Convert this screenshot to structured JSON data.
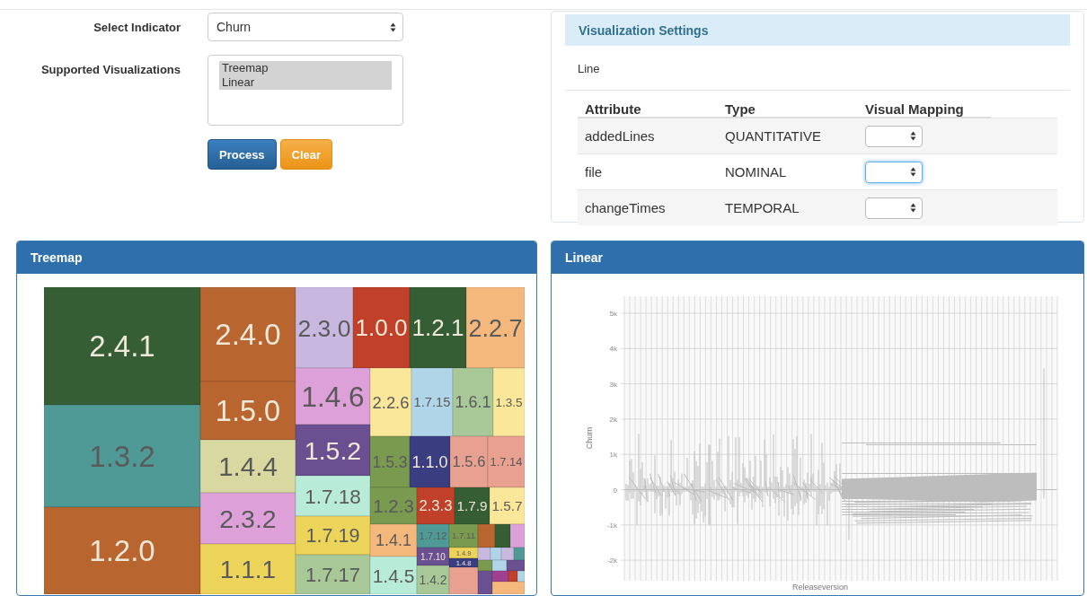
{
  "form": {
    "indicator_label": "Select Indicator",
    "indicator_value": "Churn",
    "visualizations_label": "Supported Visualizations",
    "visualizations": [
      {
        "label": "Treemap",
        "selected": true
      },
      {
        "label": "Linear",
        "selected": true
      }
    ],
    "buttons": [
      {
        "label": "Process",
        "kind": "primary"
      },
      {
        "label": "Clear",
        "kind": "warning"
      }
    ]
  },
  "settings": {
    "title": "Visualization Settings",
    "subtitle": "Line",
    "columns": [
      "Attribute",
      "Type",
      "Visual Mapping"
    ],
    "rows": [
      {
        "attribute": "addedLines",
        "type": "QUANTITATIVE",
        "focused": false
      },
      {
        "attribute": "file",
        "type": "NOMINAL",
        "focused": true
      },
      {
        "attribute": "changeTimes",
        "type": "TEMPORAL",
        "focused": false
      }
    ]
  },
  "treemap": {
    "title": "Treemap",
    "cells": [
      {
        "label": "2.4.1",
        "color": "#355e35"
      },
      {
        "label": "1.3.2",
        "color": "#4f9a96"
      },
      {
        "label": "1.2.0",
        "color": "#b8652f"
      },
      {
        "label": "2.4.0",
        "color": "#b8652f"
      },
      {
        "label": "1.5.0",
        "color": "#b8652f"
      },
      {
        "label": "1.4.4",
        "color": "#d8d8a0"
      },
      {
        "label": "2.3.2",
        "color": "#dda0d8"
      },
      {
        "label": "1.1.1",
        "color": "#ecd35a"
      },
      {
        "label": "2.3.0",
        "color": "#c8b8e0"
      },
      {
        "label": "1.0.0",
        "color": "#c0402a"
      },
      {
        "label": "1.2.1",
        "color": "#355e35"
      },
      {
        "label": "2.2.7",
        "color": "#f4b87c"
      },
      {
        "label": "1.4.6",
        "color": "#dda0d8"
      },
      {
        "label": "2.2.6",
        "color": "#fbe79a"
      },
      {
        "label": "1.7.15",
        "color": "#b0d4e8"
      },
      {
        "label": "1.6.1",
        "color": "#a8c898"
      },
      {
        "label": "1.3.5",
        "color": "#fbe79a"
      },
      {
        "label": "1.5.2",
        "color": "#6a5090"
      },
      {
        "label": "1.5.3",
        "color": "#7a9a50"
      },
      {
        "label": "1.1.0",
        "color": "#3a3e80"
      },
      {
        "label": "1.5.6",
        "color": "#e8a090"
      },
      {
        "label": "1.7.14",
        "color": "#e8a090"
      },
      {
        "label": "1.7.18",
        "color": "#b8ecd8"
      },
      {
        "label": "1.2.3",
        "color": "#7a9a50"
      },
      {
        "label": "2.3.3",
        "color": "#c0402a"
      },
      {
        "label": "1.7.9",
        "color": "#355e35"
      },
      {
        "label": "1.5.7",
        "color": "#fbe79a"
      },
      {
        "label": "1.7.19",
        "color": "#ecd35a"
      },
      {
        "label": "1.7.17",
        "color": "#a8c898"
      },
      {
        "label": "1.4.1",
        "color": "#f4b87c"
      },
      {
        "label": "1.4.5",
        "color": "#b8ecd8"
      },
      {
        "label": "1.7.12",
        "color": "#4f9a96"
      },
      {
        "label": "1.7.11",
        "color": "#7a9a50"
      },
      {
        "color": "#b8652f"
      },
      {
        "color": "#355e35"
      },
      {
        "color": "#dda0d8"
      },
      {
        "label": "1.7.10",
        "color": "#6a5090"
      },
      {
        "label": "1.4.9",
        "color": "#ecd35a"
      },
      {
        "label": "1.4.8",
        "color": "#3a3e80"
      },
      {
        "label": "1.4.2",
        "color": "#a8c898"
      },
      {
        "color": "#c8b8e0"
      },
      {
        "color": "#b0d4e8"
      },
      {
        "color": "#c8b8e0"
      },
      {
        "color": "#4f9a96"
      },
      {
        "color": "#e8a090"
      },
      {
        "color": "#7a9a50"
      },
      {
        "color": "#b0d4e8"
      },
      {
        "color": "#6a5090"
      },
      {
        "color": "#6a5090"
      },
      {
        "color": "#a04090"
      },
      {
        "color": "#c0402a"
      },
      {
        "color": "#b0d4e8"
      },
      {
        "color": "#f4b87c"
      }
    ]
  },
  "linear": {
    "title": "Linear",
    "y_axis_label": "Churn",
    "x_axis_label": "Releaseversion",
    "y_ticks": [
      "5k",
      "4k",
      "3k",
      "2k",
      "1k",
      "0",
      "-1k",
      "-2k"
    ]
  }
}
